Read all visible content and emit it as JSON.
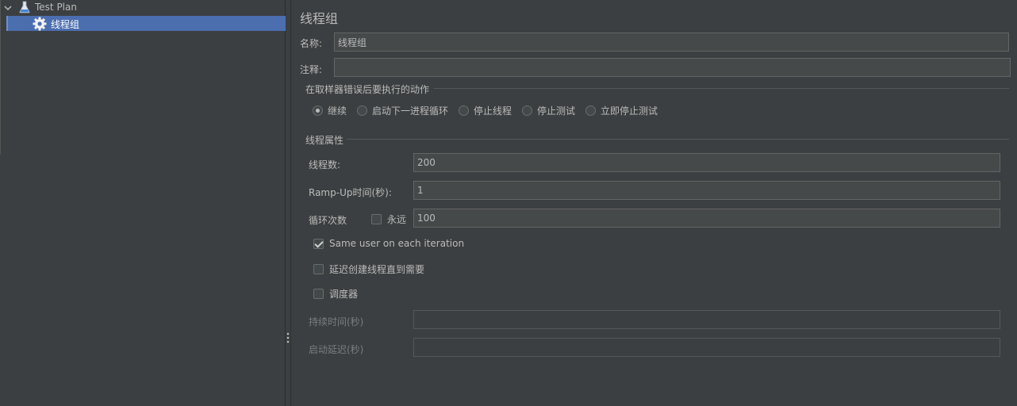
{
  "tree": {
    "items": [
      {
        "label": "Test Plan",
        "icon": "flask-icon",
        "expanded": true
      },
      {
        "label": "线程组",
        "icon": "gear-icon",
        "selected": true
      }
    ]
  },
  "form": {
    "title": "线程组",
    "name_label": "名称:",
    "name_value": "线程组",
    "comment_label": "注释:",
    "comment_value": "",
    "error_section": {
      "title": "在取样器错误后要执行的动作",
      "options": [
        "继续",
        "启动下一进程循环",
        "停止线程",
        "停止测试",
        "立即停止测试"
      ],
      "selected": "继续"
    },
    "thread_section": {
      "title": "线程属性",
      "threads_label": "线程数:",
      "threads_value": "200",
      "rampup_label": "Ramp-Up时间(秒):",
      "rampup_value": "1",
      "loop_label": "循环次数",
      "forever_label": "永远",
      "forever_checked": false,
      "loop_value": "100",
      "same_user_label": "Same user on each iteration",
      "same_user_checked": true,
      "delay_create_label": "延迟创建线程直到需要",
      "delay_create_checked": false,
      "scheduler_label": "调度器",
      "scheduler_checked": false,
      "duration_label": "持续时间(秒)",
      "duration_value": "",
      "startup_delay_label": "启动延迟(秒)",
      "startup_delay_value": ""
    }
  },
  "colors": {
    "background": "#3c3f41",
    "selection": "#4b6eaf",
    "text": "#bbbbbb",
    "field_bg": "#45494a"
  }
}
